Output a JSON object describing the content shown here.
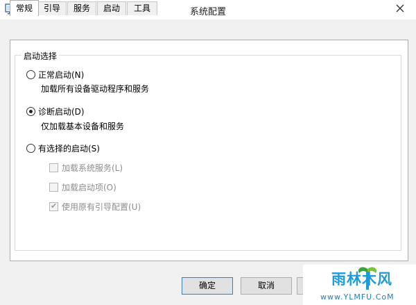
{
  "window": {
    "title": "系统配置"
  },
  "tabs": [
    {
      "label": "常规",
      "active": true
    },
    {
      "label": "引导",
      "active": false
    },
    {
      "label": "服务",
      "active": false
    },
    {
      "label": "启动",
      "active": false
    },
    {
      "label": "工具",
      "active": false
    }
  ],
  "startup_selection": {
    "legend": "启动选择",
    "options": [
      {
        "label": "正常启动(N)",
        "description": "加载所有设备驱动程序和服务",
        "checked": false
      },
      {
        "label": "诊断启动(D)",
        "description": "仅加载基本设备和服务",
        "checked": true
      },
      {
        "label": "有选择的启动(S)",
        "checked": false
      }
    ],
    "selective_items": [
      {
        "label": "加载系统服务(L)",
        "checked": false,
        "enabled": false
      },
      {
        "label": "加载启动项(O)",
        "checked": false,
        "enabled": false
      },
      {
        "label": "使用原有引导配置(U)",
        "checked": true,
        "enabled": false
      }
    ]
  },
  "buttons": {
    "ok": "确定",
    "cancel": "取消"
  },
  "watermark": {
    "brand": "雨林木风",
    "url": "www.YLMFU.CoM"
  },
  "icons": {
    "close": "close-icon",
    "app": "system-config-icon"
  }
}
